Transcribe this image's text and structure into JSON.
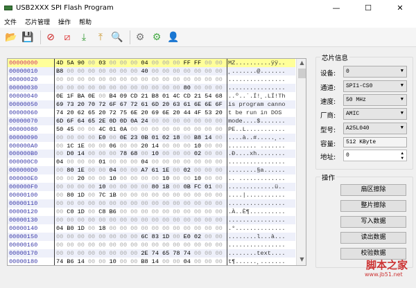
{
  "window": {
    "title": "USB2XXX SPI Flash Program",
    "minimize": "—",
    "maximize": "☐",
    "close": "✕"
  },
  "menu": [
    "文件",
    "芯片管理",
    "操作",
    "帮助"
  ],
  "toolbar": [
    "open-icon",
    "save-icon",
    "erase-sector-icon",
    "erase-chip-icon",
    "write-icon",
    "read-icon",
    "verify-icon",
    "settings-info-icon",
    "settings-refresh-icon",
    "user-icon"
  ],
  "hex": {
    "rows": [
      {
        "addr": "00000000",
        "bytes": "4D 5A 90 00 03 00 00 00 04 00 00 00 FF FF 00 00",
        "ascii": "MZ..........ÿÿ.."
      },
      {
        "addr": "00000010",
        "bytes": "B8 00 00 00 00 00 00 00 40 00 00 00 00 00 00 00",
        "ascii": "¸.......@......."
      },
      {
        "addr": "00000020",
        "bytes": "00 00 00 00 00 00 00 00 00 00 00 00 00 00 00 00",
        "ascii": "................"
      },
      {
        "addr": "00000030",
        "bytes": "00 00 00 00 00 00 00 00 00 00 00 00 80 00 00 00",
        "ascii": "................"
      },
      {
        "addr": "00000040",
        "bytes": "0E 1F BA 0E 00 B4 09 CD 21 B8 01 4C CD 21 54 68",
        "ascii": "..º..´.Í!¸.LÍ!Th"
      },
      {
        "addr": "00000050",
        "bytes": "69 73 20 70 72 6F 67 72 61 6D 20 63 61 6E 6E 6F",
        "ascii": "is program canno"
      },
      {
        "addr": "00000060",
        "bytes": "74 20 62 65 20 72 75 6E 20 69 6E 20 44 4F 53 20",
        "ascii": "t be run in DOS "
      },
      {
        "addr": "00000070",
        "bytes": "6D 6F 64 65 2E 0D 0D 0A 24 00 00 00 00 00 00 00",
        "ascii": "mode....$......."
      },
      {
        "addr": "00000080",
        "bytes": "50 45 00 00 4C 01 0A 00 00 00 00 00 00 00 00 00",
        "ascii": "PE..L..........."
      },
      {
        "addr": "00000090",
        "bytes": "00 00 00 00 E0 00 0E 23 0B 01 02 18 00 B8 14 00",
        "ascii": "....à..#.....¸.."
      },
      {
        "addr": "000000A0",
        "bytes": "00 1C 1E 00 00 06 00 00 20 14 00 00 00 10 00 00",
        "ascii": "........ ......."
      },
      {
        "addr": "000000B0",
        "bytes": "00 D0 14 00 00 00 78 68 00 10 00 00 00 02 00 00",
        "ascii": ".Ð....xh........"
      },
      {
        "addr": "000000C0",
        "bytes": "04 00 00 00 01 00 00 00 04 00 00 00 00 00 00 00",
        "ascii": "................"
      },
      {
        "addr": "000000D0",
        "bytes": "00 80 1E 00 00 04 00 00 A7 61 1E 00 02 00 00 00",
        "ascii": "........§a......"
      },
      {
        "addr": "000000E0",
        "bytes": "00 00 20 00 00 10 00 00 00 00 10 00 00 10 00 00",
        "ascii": ".. ............."
      },
      {
        "addr": "000000F0",
        "bytes": "00 00 00 00 10 00 00 00 00 80 1B 00 0B FC 01 00",
        "ascii": ".............ü.."
      },
      {
        "addr": "00000100",
        "bytes": "00 80 1D 00 7C 1B 00 00 00 00 00 00 00 00 00 00",
        "ascii": "....|..........."
      },
      {
        "addr": "00000110",
        "bytes": "00 00 00 00 00 00 00 00 00 00 00 00 00 00 00 00",
        "ascii": "................"
      },
      {
        "addr": "00000120",
        "bytes": "00 C0 1D 00 C8 B6 00 00 00 00 00 00 00 00 00 00",
        "ascii": ".À..È¶.........."
      },
      {
        "addr": "00000130",
        "bytes": "00 00 00 00 00 00 00 00 00 00 00 00 00 00 00 00",
        "ascii": "................"
      },
      {
        "addr": "00000140",
        "bytes": "04 B0 1D 00 18 00 00 00 00 00 00 00 00 00 00 00",
        "ascii": ".°.............."
      },
      {
        "addr": "00000150",
        "bytes": "00 00 00 00 00 00 00 00 6C 83 1D 00 E0 02 00 00",
        "ascii": "........l...à..."
      },
      {
        "addr": "00000160",
        "bytes": "00 00 00 00 00 00 00 00 00 00 00 00 00 00 00 00",
        "ascii": "................"
      },
      {
        "addr": "00000170",
        "bytes": "00 00 00 00 00 00 00 00 2E 74 65 78 74 00 00 00",
        "ascii": "........text...."
      },
      {
        "addr": "00000180",
        "bytes": "74 B6 14 00 00 10 00 00 B8 14 00 00 04 00 00 00",
        "ascii": "t¶......¸......."
      }
    ]
  },
  "chip_info": {
    "title": "芯片信息",
    "device": {
      "label": "设备:",
      "value": "0"
    },
    "channel": {
      "label": "通道:",
      "value": "SPI1-CS0"
    },
    "speed": {
      "label": "速度:",
      "value": "50 MHz"
    },
    "vendor": {
      "label": "厂商:",
      "value": "AMIC"
    },
    "model": {
      "label": "型号:",
      "value": "A25L040"
    },
    "capacity": {
      "label": "容量:",
      "value": "512 KByte"
    },
    "address": {
      "label": "地址:",
      "value": "0"
    }
  },
  "operations": {
    "title": "操作",
    "buttons": [
      "扇区擦除",
      "整片擦除",
      "写入数据",
      "读出数据",
      "校验数据"
    ]
  },
  "watermark": {
    "name": "脚本之家",
    "url": "www.jb51.net"
  },
  "colors": {
    "highlight_row": "#ffff99",
    "alt_row": "#eef0fa",
    "address": "#3838a8",
    "first_address": "#d0306a"
  }
}
